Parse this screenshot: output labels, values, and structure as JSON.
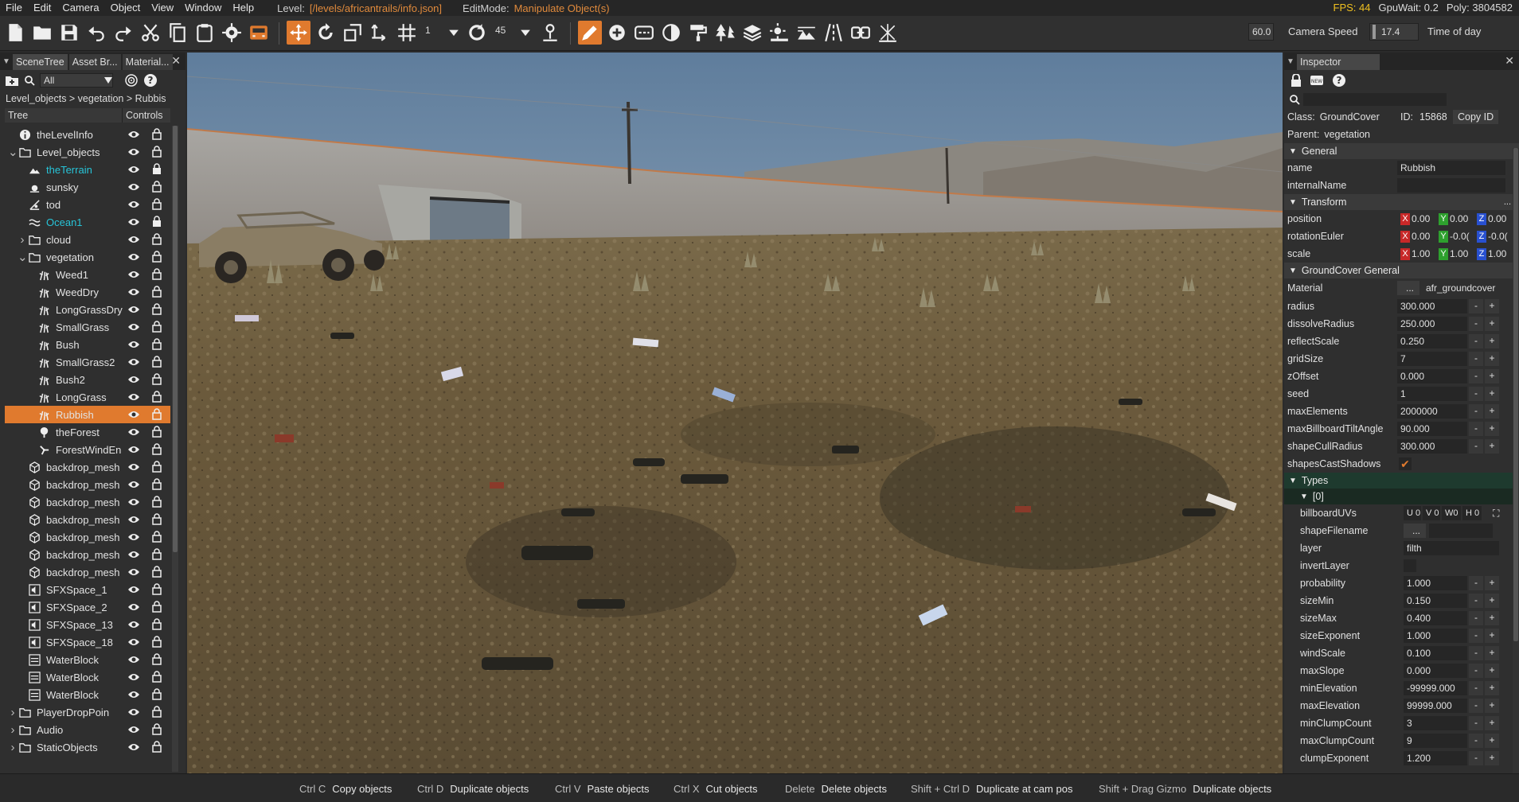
{
  "menubar": {
    "items": [
      "File",
      "Edit",
      "Camera",
      "Object",
      "View",
      "Window",
      "Help"
    ],
    "level_label": "Level:",
    "level_path": "[/levels/africantrails/info.json]",
    "editmode_label": "EditMode:",
    "editmode_value": "Manipulate Object(s)",
    "fps": "FPS: 44",
    "gpuwait": "GpuWait: 0.2",
    "poly": "Poly: 3804582"
  },
  "toolbar": {
    "snap_value": "1",
    "rotate_snap_value": "45",
    "field_value": "60.0",
    "camera_speed_label": "Camera Speed",
    "camera_speed_value": "17.4",
    "time_of_day_label": "Time of day"
  },
  "left_panel": {
    "tabs": [
      "SceneTree",
      "Asset Br...",
      "Material..."
    ],
    "filter_value": "All",
    "breadcrumb": "Level_objects  >  vegetation  >  Rubbis",
    "col_tree": "Tree",
    "col_controls": "Controls",
    "rows": [
      {
        "label": "theLevelInfo",
        "icon": "info-icon",
        "indent": 0,
        "arrow": ""
      },
      {
        "label": "Level_objects",
        "icon": "folder-icon",
        "indent": 0,
        "arrow": "v"
      },
      {
        "label": "theTerrain",
        "icon": "terrain-icon",
        "indent": 1,
        "arrow": "",
        "teal": true
      },
      {
        "label": "sunsky",
        "icon": "sun-icon",
        "indent": 1,
        "arrow": ""
      },
      {
        "label": "tod",
        "icon": "tod-icon",
        "indent": 1,
        "arrow": ""
      },
      {
        "label": "Ocean1",
        "icon": "wave-icon",
        "indent": 1,
        "arrow": "",
        "teal": true
      },
      {
        "label": "cloud",
        "icon": "folder-icon",
        "indent": 1,
        "arrow": ">"
      },
      {
        "label": "vegetation",
        "icon": "folder-icon",
        "indent": 1,
        "arrow": "v"
      },
      {
        "label": "Weed1",
        "icon": "grass-icon",
        "indent": 2,
        "arrow": ""
      },
      {
        "label": "WeedDry",
        "icon": "grass-icon",
        "indent": 2,
        "arrow": ""
      },
      {
        "label": "LongGrassDry",
        "icon": "grass-icon",
        "indent": 2,
        "arrow": ""
      },
      {
        "label": "SmallGrass",
        "icon": "grass-icon",
        "indent": 2,
        "arrow": ""
      },
      {
        "label": "Bush",
        "icon": "grass-icon",
        "indent": 2,
        "arrow": ""
      },
      {
        "label": "SmallGrass2",
        "icon": "grass-icon",
        "indent": 2,
        "arrow": ""
      },
      {
        "label": "Bush2",
        "icon": "grass-icon",
        "indent": 2,
        "arrow": ""
      },
      {
        "label": "LongGrass",
        "icon": "grass-icon",
        "indent": 2,
        "arrow": ""
      },
      {
        "label": "Rubbish",
        "icon": "grass-icon",
        "indent": 2,
        "arrow": "",
        "selected": true
      },
      {
        "label": "theForest",
        "icon": "forest-icon",
        "indent": 2,
        "arrow": ""
      },
      {
        "label": "ForestWindEn",
        "icon": "wind-icon",
        "indent": 2,
        "arrow": ""
      },
      {
        "label": "backdrop_mesh",
        "icon": "mesh-icon",
        "indent": 1,
        "arrow": ""
      },
      {
        "label": "backdrop_mesh",
        "icon": "mesh-icon",
        "indent": 1,
        "arrow": ""
      },
      {
        "label": "backdrop_mesh",
        "icon": "mesh-icon",
        "indent": 1,
        "arrow": ""
      },
      {
        "label": "backdrop_mesh",
        "icon": "mesh-icon",
        "indent": 1,
        "arrow": ""
      },
      {
        "label": "backdrop_mesh",
        "icon": "mesh-icon",
        "indent": 1,
        "arrow": ""
      },
      {
        "label": "backdrop_mesh",
        "icon": "mesh-icon",
        "indent": 1,
        "arrow": ""
      },
      {
        "label": "backdrop_mesh",
        "icon": "mesh-icon",
        "indent": 1,
        "arrow": ""
      },
      {
        "label": "SFXSpace_1",
        "icon": "speaker-icon",
        "indent": 1,
        "arrow": ""
      },
      {
        "label": "SFXSpace_2",
        "icon": "speaker-icon",
        "indent": 1,
        "arrow": ""
      },
      {
        "label": "SFXSpace_13",
        "icon": "speaker-icon",
        "indent": 1,
        "arrow": ""
      },
      {
        "label": "SFXSpace_18",
        "icon": "speaker-icon",
        "indent": 1,
        "arrow": ""
      },
      {
        "label": "WaterBlock",
        "icon": "water-icon",
        "indent": 1,
        "arrow": ""
      },
      {
        "label": "WaterBlock",
        "icon": "water-icon",
        "indent": 1,
        "arrow": ""
      },
      {
        "label": "WaterBlock",
        "icon": "water-icon",
        "indent": 1,
        "arrow": ""
      },
      {
        "label": "PlayerDropPoin",
        "icon": "folder-icon",
        "indent": 0,
        "arrow": ">"
      },
      {
        "label": "Audio",
        "icon": "folder-icon",
        "indent": 0,
        "arrow": ">"
      },
      {
        "label": "StaticObjects",
        "icon": "folder-icon",
        "indent": 0,
        "arrow": ">"
      }
    ]
  },
  "inspector": {
    "tab": "Inspector",
    "class_label": "Class:",
    "class_value": "GroundCover",
    "id_label": "ID:",
    "id_value": "15868",
    "copy_id": "Copy ID",
    "parent_label": "Parent:",
    "parent_value": "vegetation",
    "sec_general": "General",
    "sec_transform": "Transform",
    "sec_groundcover": "GroundCover General",
    "sec_types": "Types",
    "sec_types_item": "[0]",
    "name_label": "name",
    "name_value": "Rubbish",
    "internalname_label": "internalName",
    "position_label": "position",
    "position": [
      "0.00",
      "0.00",
      "0.00"
    ],
    "rotation_label": "rotationEuler",
    "rotation": [
      "0.00",
      "-0.0(",
      "-0.0("
    ],
    "scale_label": "scale",
    "scale": [
      "1.00",
      "1.00",
      "1.00"
    ],
    "material_label": "Material",
    "material_btn": "...",
    "material_value": "afr_groundcover",
    "fields": [
      {
        "label": "radius",
        "value": "300.000"
      },
      {
        "label": "dissolveRadius",
        "value": "250.000"
      },
      {
        "label": "reflectScale",
        "value": "0.250"
      },
      {
        "label": "gridSize",
        "value": "7"
      },
      {
        "label": "zOffset",
        "value": "0.000"
      },
      {
        "label": "seed",
        "value": "1"
      },
      {
        "label": "maxElements",
        "value": "2000000"
      },
      {
        "label": "maxBillboardTiltAngle",
        "value": "90.000"
      },
      {
        "label": "shapeCullRadius",
        "value": "300.000"
      }
    ],
    "shapes_cast_label": "shapesCastShadows",
    "billboard_label": "billboardUVs",
    "billboard_values": [
      "U 0",
      "V 0",
      "W0",
      "H 0"
    ],
    "shape_filename_label": "shapeFilename",
    "shape_filename_btn": "...",
    "layer_label": "layer",
    "layer_value": "filth",
    "invert_layer_label": "invertLayer",
    "type_fields": [
      {
        "label": "probability",
        "value": "1.000"
      },
      {
        "label": "sizeMin",
        "value": "0.150"
      },
      {
        "label": "sizeMax",
        "value": "0.400"
      },
      {
        "label": "sizeExponent",
        "value": "1.000"
      },
      {
        "label": "windScale",
        "value": "0.100"
      },
      {
        "label": "maxSlope",
        "value": "0.000"
      },
      {
        "label": "minElevation",
        "value": "-99999.000"
      },
      {
        "label": "maxElevation",
        "value": "99999.000"
      },
      {
        "label": "minClumpCount",
        "value": "3"
      },
      {
        "label": "maxClumpCount",
        "value": "9"
      },
      {
        "label": "clumpExponent",
        "value": "1.200"
      }
    ]
  },
  "shortcuts": [
    {
      "key": "Ctrl C",
      "action": "Copy objects"
    },
    {
      "key": "Ctrl D",
      "action": "Duplicate objects"
    },
    {
      "key": "Ctrl V",
      "action": "Paste objects"
    },
    {
      "key": "Ctrl X",
      "action": "Cut objects"
    },
    {
      "key": "Delete",
      "action": "Delete objects"
    },
    {
      "key": "Shift + Ctrl D",
      "action": "Duplicate at cam pos"
    },
    {
      "key": "Shift + Drag Gizmo",
      "action": "Duplicate objects"
    }
  ],
  "colors": {
    "accent": "#e07a2e",
    "teal": "#27c4d8",
    "fps": "#f0c020",
    "path": "#e08a3c"
  }
}
